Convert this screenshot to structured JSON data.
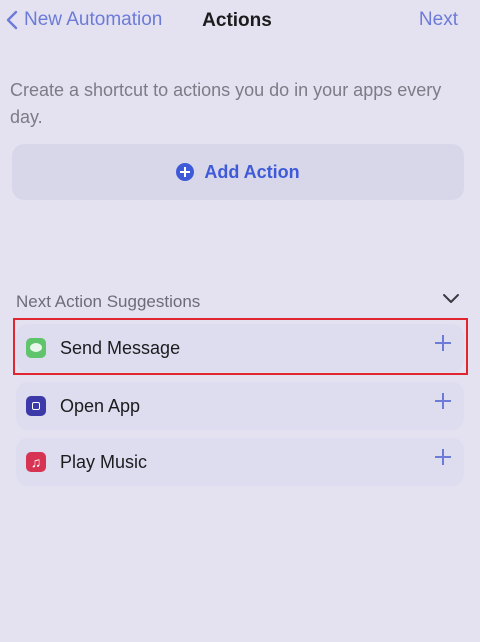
{
  "nav": {
    "back_label": "New Automation",
    "title": "Actions",
    "next_label": "Next"
  },
  "description": "Create a shortcut to actions you do in your apps every day.",
  "add_action": {
    "label": "Add Action",
    "icon": "plus-circle-icon"
  },
  "suggestions": {
    "header": "Next Action Suggestions",
    "items": [
      {
        "label": "Send Message",
        "icon": "messages-app-icon"
      },
      {
        "label": "Open App",
        "icon": "open-app-icon"
      },
      {
        "label": "Play Music",
        "icon": "music-app-icon"
      }
    ]
  },
  "colors": {
    "accent": "#6c7bd8",
    "add_action_blue": "#3f5ad8",
    "highlight": "#e0262e",
    "background": "#e4e2f1"
  }
}
